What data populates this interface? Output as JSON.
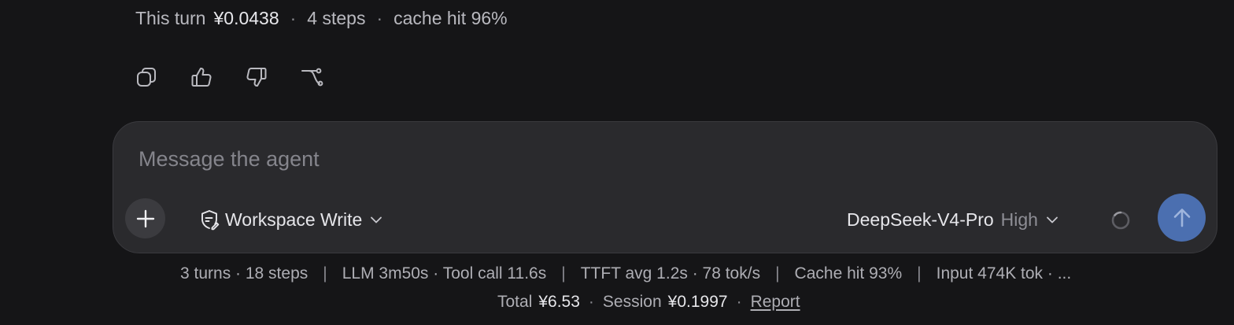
{
  "turn_summary": {
    "label": "This turn",
    "cost": "¥0.0438",
    "steps": "4 steps",
    "cache": "cache hit 96%",
    "separator": "·"
  },
  "message_actions": [
    {
      "name": "copy",
      "icon": "copy-icon"
    },
    {
      "name": "thumbs-up",
      "icon": "thumbs-up-icon"
    },
    {
      "name": "thumbs-down",
      "icon": "thumbs-down-icon"
    },
    {
      "name": "branch",
      "icon": "branch-icon"
    }
  ],
  "composer": {
    "placeholder": "Message the agent",
    "value": "",
    "add_icon": "plus-icon",
    "mode": {
      "icon": "shield-edit-icon",
      "label": "Workspace Write"
    },
    "model": {
      "name": "DeepSeek-V4-Pro",
      "effort": "High"
    },
    "status_icon": "spinner-icon",
    "send_icon": "arrow-up-icon"
  },
  "footer": {
    "stats": [
      "3 turns · 18 steps",
      "LLM 3m50s · Tool call 11.6s",
      "TTFT avg 1.2s · 78 tok/s",
      "Cache hit 93%",
      "Input 474K tok · ..."
    ],
    "stats_separator": "|",
    "total_label": "Total",
    "total_value": "¥6.53",
    "session_label": "Session",
    "session_value": "¥0.1997",
    "dot": "·",
    "report_label": "Report"
  },
  "colors": {
    "background": "#151517",
    "composer_bg": "#2a2a2d",
    "send_button": "#4b6fb0",
    "text_muted": "#aeaeb4",
    "text_strong": "#e6e6ea"
  }
}
